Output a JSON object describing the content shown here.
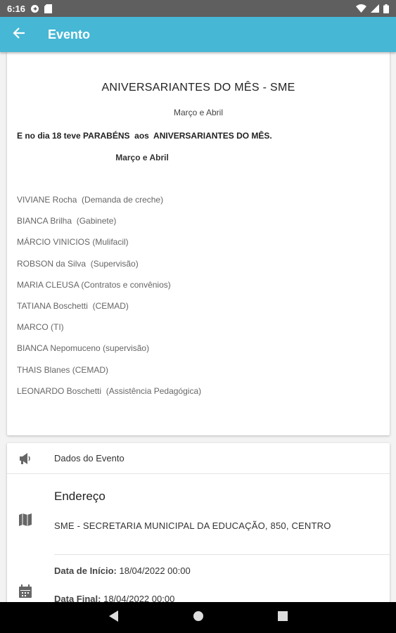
{
  "status_bar": {
    "time": "6:16",
    "icons": [
      "play-protect-icon",
      "sd-card-icon",
      "wifi-icon",
      "signal-icon",
      "battery-icon"
    ]
  },
  "app_bar": {
    "title": "Evento",
    "background_color": "#46b7d5",
    "back_icon": "arrow-left-icon"
  },
  "description": {
    "title": "ANIVERSARIANTES DO MÊS - SME",
    "subtitle": "Março e Abril",
    "bold_line": "E no dia 18 teve PARABÉNS  aos  ANIVERSARIANTES DO MÊS.",
    "bold_subtitle": "Março e Abril",
    "people": [
      "VIVIANE Rocha  (Demanda de creche)",
      "BIANCA Brilha  (Gabinete)",
      "MÁRCIO VINICIOS (Mulifacil)",
      "ROBSON da Silva  (Supervisão)",
      "MARIA CLEUSA (Contratos e convênios)",
      "TATIANA Boschetti  (CEMAD)",
      "MARCO (TI)",
      "BIANCA Nepomuceno (supervisão)",
      "THAIS Blanes (CEMAD)",
      "LEONARDO Boschetti  (Assistência Pedagógica)"
    ]
  },
  "event_data": {
    "header_label": "Dados do Evento",
    "header_icon": "megaphone-icon",
    "address_title": "Endereço",
    "address_icon": "map-icon",
    "address_value": "SME - SECRETARIA MUNICIPAL DA EDUCAÇÃO, 850, CENTRO",
    "date_icon": "calendar-icon",
    "start_label": "Data de Início:",
    "start_value": "18/04/2022 00:00",
    "end_label": "Data Final:",
    "end_value": "18/04/2022 00:00"
  },
  "nav_bar": {
    "buttons": [
      "back-triangle-icon",
      "home-circle-icon",
      "recents-square-icon"
    ]
  }
}
